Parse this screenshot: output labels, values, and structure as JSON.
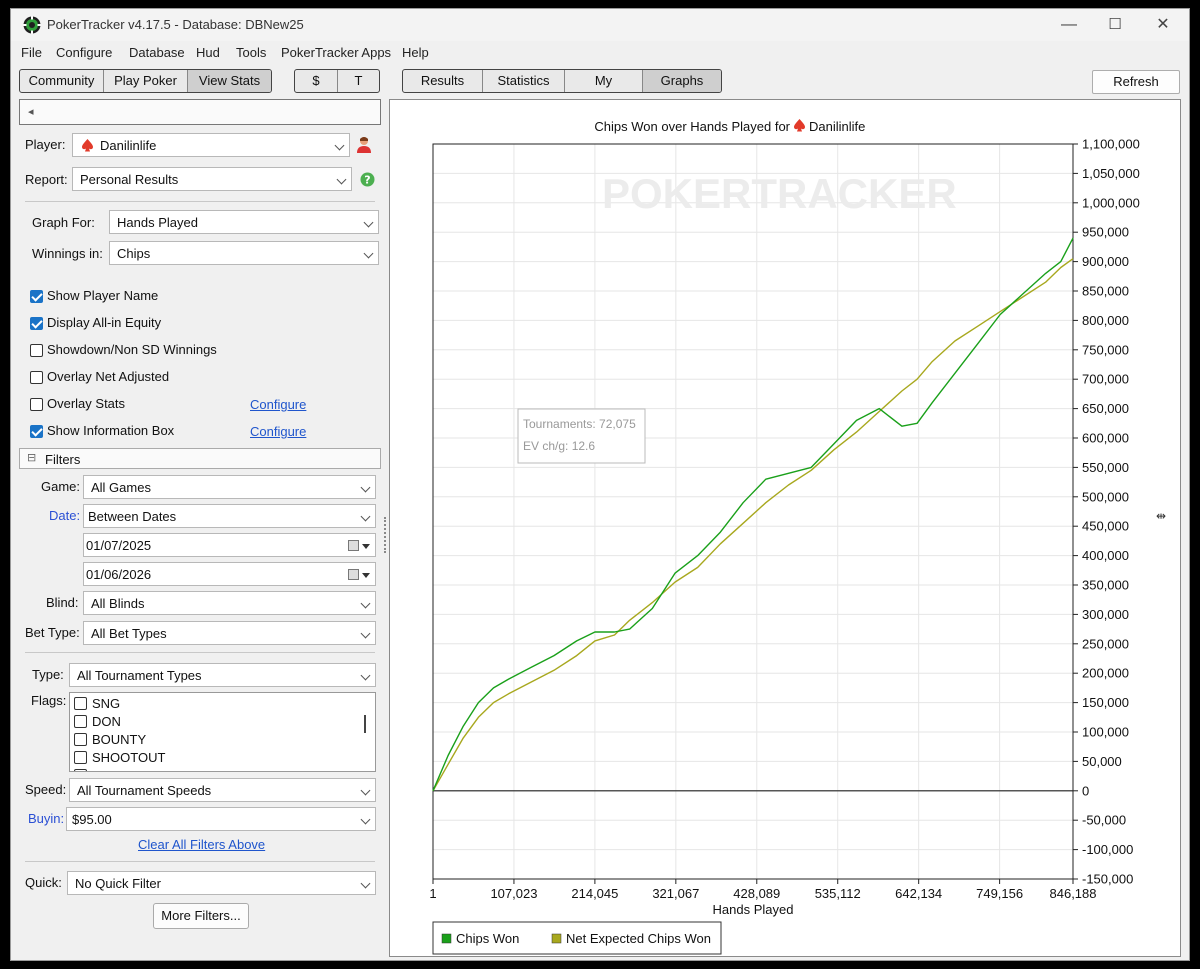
{
  "window": {
    "title": "PokerTracker v4.17.5 - Database: DBNew25",
    "minimize": "—",
    "maximize": "☐",
    "close": "✕"
  },
  "menu": [
    "File",
    "Configure",
    "Database",
    "Hud",
    "Tools",
    "PokerTracker Apps",
    "Help"
  ],
  "toolbar": {
    "nav": [
      "Community",
      "Play Poker",
      "View Stats"
    ],
    "currency": [
      "$",
      "T"
    ],
    "views": [
      "Results",
      "Statistics",
      "My Reports",
      "Graphs"
    ],
    "refresh": "Refresh"
  },
  "left": {
    "collapse_glyph": "◂",
    "player_label": "Player:",
    "player_value": "Danilinlife",
    "report_label": "Report:",
    "report_value": "Personal Results",
    "graph_for_label": "Graph For:",
    "graph_for_value": "Hands Played",
    "winnings_label": "Winnings in:",
    "winnings_value": "Chips",
    "options": [
      {
        "label": "Show Player Name",
        "checked": true
      },
      {
        "label": "Display All-in Equity",
        "checked": true
      },
      {
        "label": "Showdown/Non SD Winnings",
        "checked": false
      },
      {
        "label": "Overlay Net Adjusted",
        "checked": false
      },
      {
        "label": "Overlay Stats",
        "checked": false
      },
      {
        "label": "Show Information Box",
        "checked": true
      }
    ],
    "configure_link": "Configure",
    "filters_title": "Filters",
    "filters_glyph": "⊟",
    "game_label": "Game:",
    "game_value": "All Games",
    "date_label": "Date:",
    "date_value": "Between Dates",
    "date_from": "01/07/2025",
    "date_to": "01/06/2026",
    "blind_label": "Blind:",
    "blind_value": "All Blinds",
    "bet_type_label": "Bet Type:",
    "bet_type_value": "All Bet Types",
    "type_label": "Type:",
    "type_value": "All Tournament Types",
    "flags_label": "Flags:",
    "flags": [
      "SNG",
      "DON",
      "BOUNTY",
      "SHOOTOUT"
    ],
    "speed_label": "Speed:",
    "speed_value": "All Tournament Speeds",
    "buyin_label": "Buyin:",
    "buyin_value": "$95.00",
    "clear_filters": "Clear All Filters Above",
    "quick_label": "Quick:",
    "quick_value": "No Quick Filter",
    "more_filters": "More Filters..."
  },
  "colors": {
    "chips_won": "#1aa01a",
    "net_expected": "#a8a81e",
    "suit_red": "#e23a2a",
    "checkbox_blue": "#1a73c7"
  },
  "chart_data": {
    "type": "line",
    "title": "Chips Won over Hands Played for",
    "title_player": "Danilinlife",
    "watermark": "POKERTRACKER",
    "xlabel": "Hands Played",
    "ylabel": "",
    "xlim": [
      1,
      846188
    ],
    "ylim": [
      -150000,
      1100000
    ],
    "xticks": [
      1,
      107023,
      214045,
      321067,
      428089,
      535112,
      642134,
      749156,
      846188
    ],
    "xtick_labels": [
      "1",
      "107,023",
      "214,045",
      "321,067",
      "428,089",
      "535,112",
      "642,134",
      "749,156",
      "846,188"
    ],
    "yticks": [
      1100000,
      1050000,
      1000000,
      950000,
      900000,
      850000,
      800000,
      750000,
      700000,
      650000,
      600000,
      550000,
      500000,
      450000,
      400000,
      350000,
      300000,
      250000,
      200000,
      150000,
      100000,
      50000,
      0,
      -50000,
      -100000,
      -150000
    ],
    "ytick_labels": [
      "1,100,000",
      "1,050,000",
      "1,000,000",
      "950,000",
      "900,000",
      "850,000",
      "800,000",
      "750,000",
      "700,000",
      "650,000",
      "600,000",
      "550,000",
      "500,000",
      "450,000",
      "400,000",
      "350,000",
      "300,000",
      "250,000",
      "200,000",
      "150,000",
      "100,000",
      "50,000",
      "0",
      "-50,000",
      "-100,000",
      "-150,000"
    ],
    "grid": true,
    "legend_position": "bottom-left",
    "info_box": {
      "line1": "Tournaments: 72,075",
      "line2": "EV ch/g: 12.6"
    },
    "series": [
      {
        "name": "Chips Won",
        "color": "#1aa01a",
        "x": [
          1,
          20000,
          40000,
          60000,
          80000,
          100000,
          130000,
          160000,
          190000,
          214045,
          240000,
          260000,
          290000,
          320000,
          350000,
          380000,
          410000,
          440000,
          470000,
          500000,
          530000,
          560000,
          590000,
          620000,
          640000,
          660000,
          690000,
          720000,
          750000,
          780000,
          810000,
          830000,
          846188
        ],
        "y": [
          0,
          60000,
          110000,
          150000,
          175000,
          190000,
          210000,
          230000,
          255000,
          270000,
          270000,
          275000,
          310000,
          370000,
          400000,
          440000,
          490000,
          530000,
          540000,
          550000,
          590000,
          630000,
          650000,
          620000,
          625000,
          660000,
          710000,
          760000,
          810000,
          845000,
          880000,
          900000,
          940000
        ]
      },
      {
        "name": "Net Expected Chips Won",
        "color": "#a8a81e",
        "x": [
          1,
          20000,
          40000,
          60000,
          80000,
          100000,
          130000,
          160000,
          190000,
          214045,
          240000,
          260000,
          290000,
          320000,
          350000,
          380000,
          410000,
          440000,
          470000,
          500000,
          530000,
          560000,
          590000,
          620000,
          640000,
          660000,
          690000,
          720000,
          750000,
          780000,
          810000,
          830000,
          846188
        ],
        "y": [
          0,
          45000,
          90000,
          125000,
          150000,
          165000,
          185000,
          205000,
          230000,
          255000,
          265000,
          290000,
          320000,
          355000,
          380000,
          420000,
          455000,
          490000,
          520000,
          545000,
          580000,
          610000,
          645000,
          680000,
          700000,
          730000,
          765000,
          790000,
          815000,
          840000,
          865000,
          890000,
          905000
        ]
      }
    ]
  }
}
